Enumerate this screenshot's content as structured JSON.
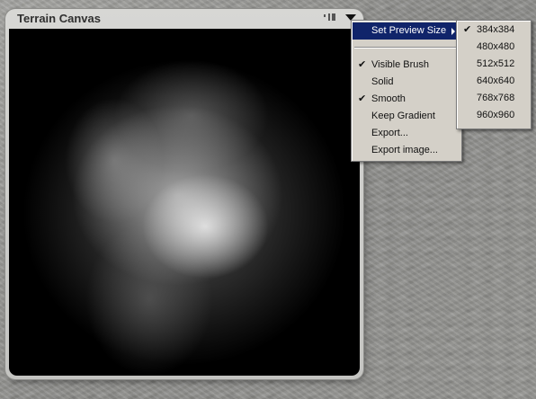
{
  "panel": {
    "title": "Terrain Canvas"
  },
  "menu": {
    "submenu_item": "Set Preview Size",
    "items": [
      {
        "label": "Visible Brush",
        "checked": true
      },
      {
        "label": "Solid",
        "checked": false
      },
      {
        "label": "Smooth",
        "checked": true
      },
      {
        "label": "Keep Gradient",
        "checked": false
      },
      {
        "label": "Export...",
        "checked": false
      },
      {
        "label": "Export image...",
        "checked": false
      }
    ]
  },
  "preview_sizes": {
    "selected": "384x384",
    "options": [
      "384x384",
      "480x480",
      "512x512",
      "640x640",
      "768x768",
      "960x960"
    ]
  },
  "colors": {
    "highlight": "#10246a",
    "menu_background": "#d4d0c8",
    "panel_background": "#d0d0cd",
    "canvas_background": "#000000"
  }
}
